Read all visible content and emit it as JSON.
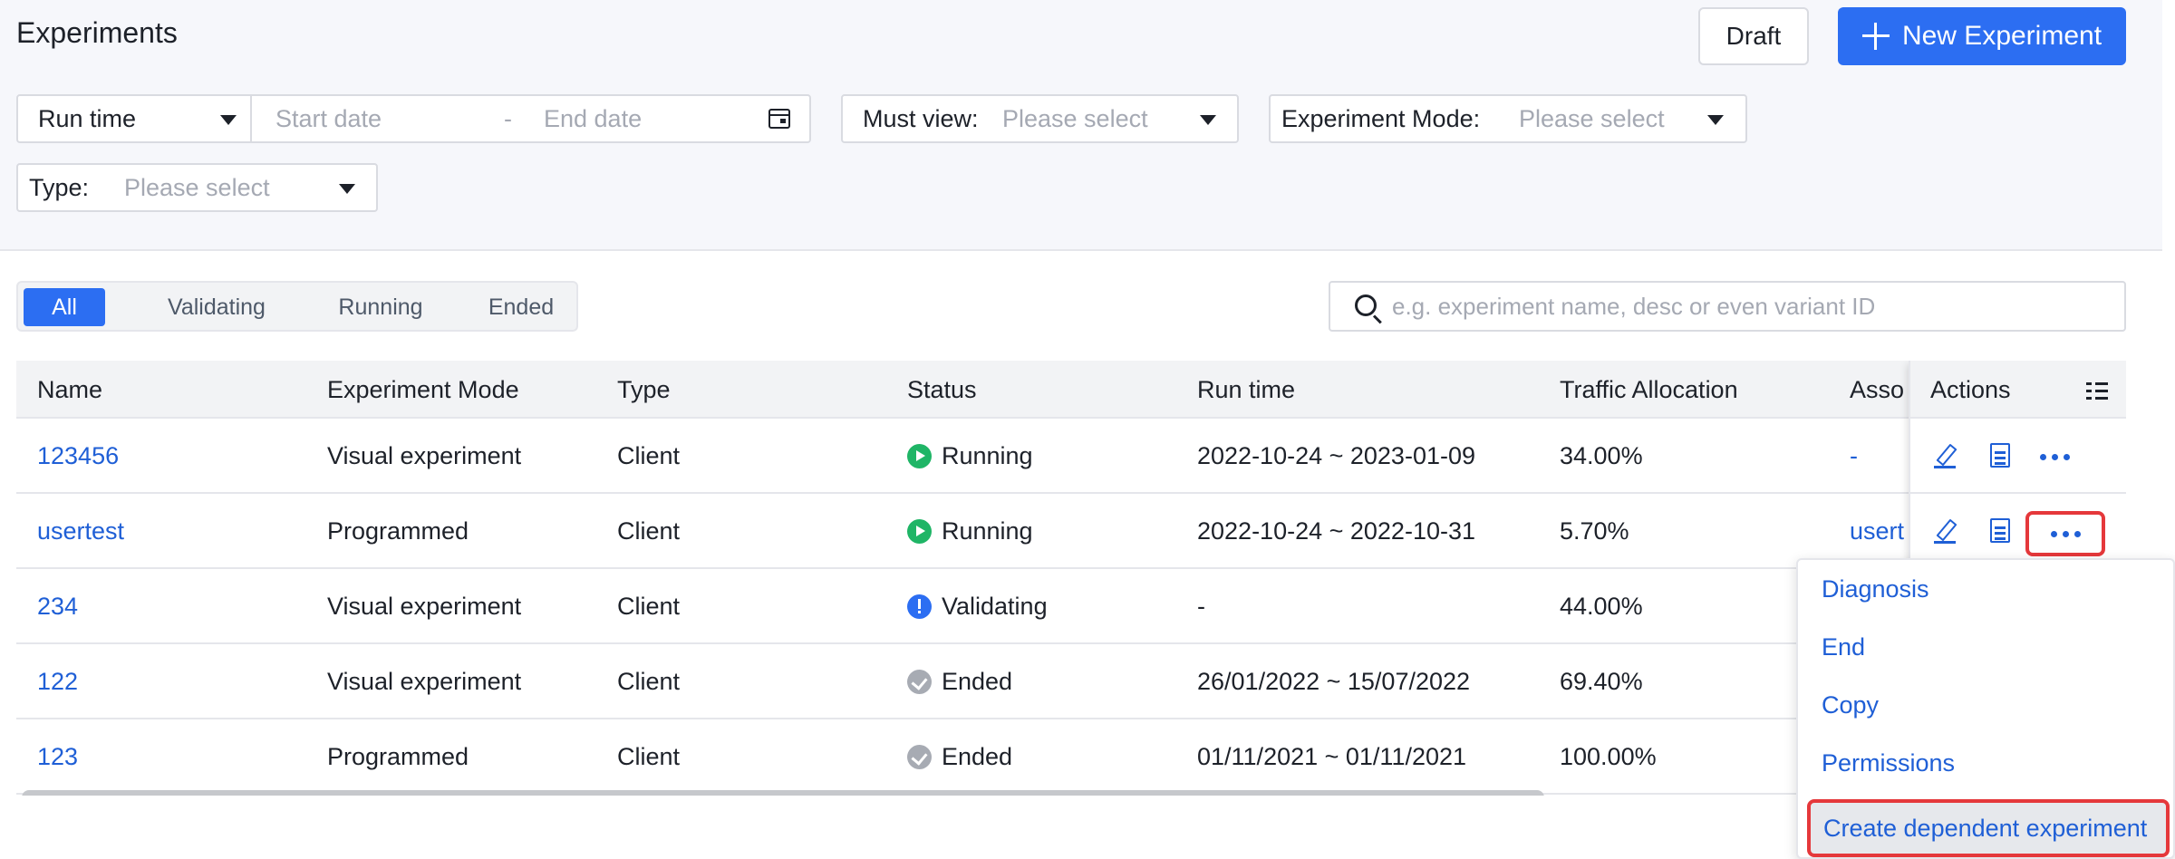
{
  "header": {
    "title": "Experiments",
    "draft_label": "Draft",
    "new_label": "New Experiment"
  },
  "filters": {
    "runtime_label": "Run time",
    "start_placeholder": "Start date",
    "dash": "-",
    "end_placeholder": "End date",
    "mustview_label": "Must view:",
    "mustview_placeholder": "Please select",
    "mode_label": "Experiment Mode:",
    "mode_placeholder": "Please select",
    "type_label": "Type:",
    "type_placeholder": "Please select"
  },
  "tabs": [
    "All",
    "Validating",
    "Running",
    "Ended"
  ],
  "search": {
    "placeholder": "e.g. experiment name, desc or even variant ID"
  },
  "table": {
    "columns": [
      "Name",
      "Experiment Mode",
      "Type",
      "Status",
      "Run time",
      "Traffic Allocation",
      "Asso",
      "Actions"
    ],
    "rows": [
      {
        "name": "123456",
        "mode": "Visual experiment",
        "type": "Client",
        "status": "Running",
        "runtime": "2022-10-24 ~ 2023-01-09",
        "traffic": "34.00%",
        "asso": "-"
      },
      {
        "name": "usertest",
        "mode": "Programmed",
        "type": "Client",
        "status": "Running",
        "runtime": "2022-10-24 ~ 2022-10-31",
        "traffic": "5.70%",
        "asso": "usert"
      },
      {
        "name": "234",
        "mode": "Visual experiment",
        "type": "Client",
        "status": "Validating",
        "runtime": "-",
        "traffic": "44.00%",
        "asso": ""
      },
      {
        "name": "122",
        "mode": "Visual experiment",
        "type": "Client",
        "status": "Ended",
        "runtime": "26/01/2022 ~ 15/07/2022",
        "traffic": "69.40%",
        "asso": ""
      },
      {
        "name": "123",
        "mode": "Programmed",
        "type": "Client",
        "status": "Ended",
        "runtime": "01/11/2021 ~ 01/11/2021",
        "traffic": "100.00%",
        "asso": ""
      }
    ]
  },
  "menu": {
    "items": [
      "Diagnosis",
      "End",
      "Copy",
      "Permissions",
      "Create dependent experiment"
    ]
  },
  "colors": {
    "primary": "#2c6ef2",
    "link": "#1f5fd6",
    "running": "#1fb566",
    "ended": "#a7abb3",
    "highlight": "#e5383b"
  }
}
